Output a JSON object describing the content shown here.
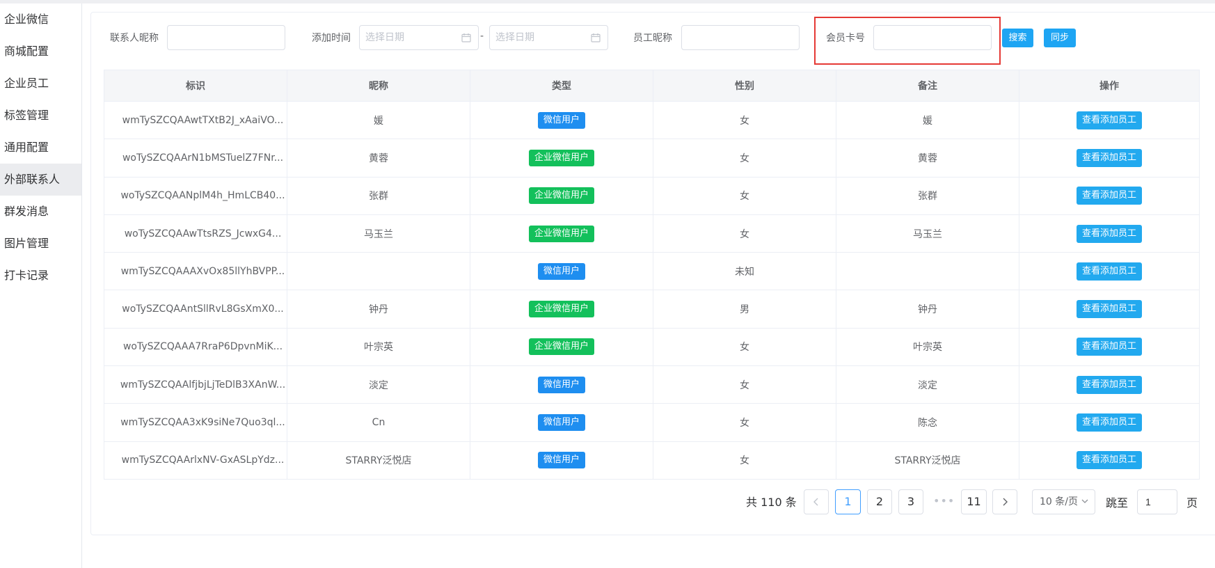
{
  "sidebar": {
    "items": [
      {
        "label": "企业微信"
      },
      {
        "label": "商城配置"
      },
      {
        "label": "企业员工"
      },
      {
        "label": "标签管理"
      },
      {
        "label": "通用配置"
      },
      {
        "label": "外部联系人",
        "active": true
      },
      {
        "label": "群发消息"
      },
      {
        "label": "图片管理"
      },
      {
        "label": "打卡记录"
      }
    ]
  },
  "filters": {
    "contact_nickname_label": "联系人昵称",
    "contact_nickname_value": "",
    "add_time_label": "添加时间",
    "start_date_placeholder": "选择日期",
    "date_separator": "-",
    "end_date_placeholder": "选择日期",
    "employee_nickname_label": "员工昵称",
    "employee_nickname_value": "",
    "member_card_label": "会员卡号",
    "member_card_value": "",
    "search_button": "搜索",
    "sync_button": "同步"
  },
  "table": {
    "columns": [
      "标识",
      "昵称",
      "类型",
      "性别",
      "备注",
      "操作"
    ],
    "rows": [
      {
        "id": "wmTySZCQAAwtTXtB2J_xAaiVO...",
        "nickname": "媛",
        "type": "微信用户",
        "type_kind": "wechat",
        "gender": "女",
        "remark": "媛",
        "action": "查看添加员工"
      },
      {
        "id": "woTySZCQAArN1bMSTuelZ7FNr...",
        "nickname": "黄蓉",
        "type": "企业微信用户",
        "type_kind": "work",
        "gender": "女",
        "remark": "黄蓉",
        "action": "查看添加员工"
      },
      {
        "id": "woTySZCQAANplM4h_HmLCB40...",
        "nickname": "张群",
        "type": "企业微信用户",
        "type_kind": "work",
        "gender": "女",
        "remark": "张群",
        "action": "查看添加员工"
      },
      {
        "id": "woTySZCQAAwTtsRZS_JcwxG4...",
        "nickname": "马玉兰",
        "type": "企业微信用户",
        "type_kind": "work",
        "gender": "女",
        "remark": "马玉兰",
        "action": "查看添加员工"
      },
      {
        "id": "wmTySZCQAAAXvOx85llYhBVPP...",
        "nickname": "",
        "type": "微信用户",
        "type_kind": "wechat",
        "gender": "未知",
        "remark": "",
        "action": "查看添加员工"
      },
      {
        "id": "woTySZCQAAntSllRvL8GsXmX0...",
        "nickname": "钟丹",
        "type": "企业微信用户",
        "type_kind": "work",
        "gender": "男",
        "remark": "钟丹",
        "action": "查看添加员工"
      },
      {
        "id": "woTySZCQAAA7RraP6DpvnMiK...",
        "nickname": "叶宗英",
        "type": "企业微信用户",
        "type_kind": "work",
        "gender": "女",
        "remark": "叶宗英",
        "action": "查看添加员工"
      },
      {
        "id": "wmTySZCQAAlfjbjLjTeDlB3XAnW...",
        "nickname": "淡定",
        "type": "微信用户",
        "type_kind": "wechat",
        "gender": "女",
        "remark": "淡定",
        "action": "查看添加员工"
      },
      {
        "id": "wmTySZCQAA3xK9siNe7Quo3ql...",
        "nickname": "Cn",
        "type": "微信用户",
        "type_kind": "wechat",
        "gender": "女",
        "remark": "陈念",
        "action": "查看添加员工"
      },
      {
        "id": "wmTySZCQAArlxNV-GxASLpYdz...",
        "nickname": "STARRY泛悦店",
        "type": "微信用户",
        "type_kind": "wechat",
        "gender": "女",
        "remark": "STARRY泛悦店",
        "action": "查看添加员工"
      }
    ]
  },
  "pagination": {
    "total_text": "共 110 条",
    "pages": [
      "1",
      "2",
      "3",
      "11"
    ],
    "current_page": "1",
    "more": "•••",
    "prev_icon": "chevron-left-icon",
    "next_icon": "chevron-right-icon",
    "page_size": "10 条/页",
    "jump_label": "跳至",
    "jump_value": "1",
    "page_suffix": "页"
  },
  "colors": {
    "highlight_border": "#e53935",
    "wechat_tag": "#1e8ef0",
    "work_tag": "#13c05b",
    "action_button": "#22a9ef",
    "primary_button": "#1ea5f3"
  }
}
